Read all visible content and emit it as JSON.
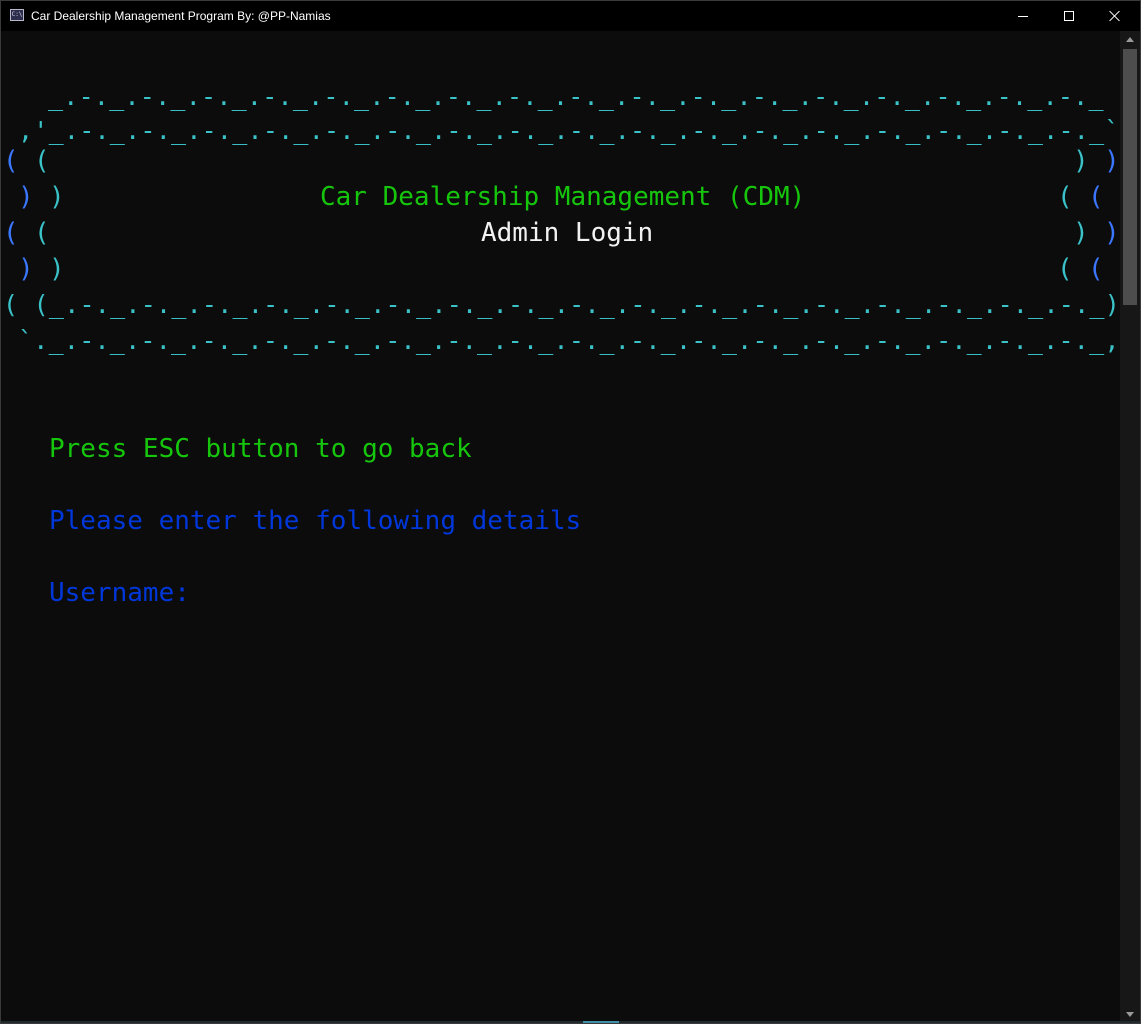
{
  "window": {
    "title": "Car Dealership Management Program By: @PP-Namias",
    "icon_label": "C:\\",
    "controls": {
      "minimize_icon": "minimize-icon",
      "maximize_icon": "maximize-icon",
      "close_icon": "close-icon"
    }
  },
  "banner": {
    "top_edge_1": "_.-._.-._.-._.-._.-._.-._.-._.-._.-._.-._.-._.-._.-._.-._.-._.-._.-._",
    "top_edge_2": ",'_.-._.-._.-._.-._.-._.-._.-._.-._.-._.-._.-._.-._.-._.-._.-._.-._.-._`.",
    "bottom_edge_1": "( (_.-._.-._.-._.-._.-._.-._.-._.-._.-._.-._.-._.-._.-._.-._.-._.-._.-._) )",
    "bottom_edge_2": "`._.-._.-._.-._.-._.-._.-._.-._.-._.-._.-._.-._.-._.-._.-._.-._.-._.-._,'",
    "left_paren_a": "(",
    "left_paren_b": ")",
    "right_paren_a": ")",
    "right_paren_b": "(",
    "title": "Car Dealership Management (CDM)",
    "subtitle": "Admin Login"
  },
  "prompt": {
    "esc_hint": "Press ESC button to go back",
    "instruction": "Please enter the following details",
    "username_label": "Username:"
  },
  "colors": {
    "background": "#0c0c0c",
    "cyan": "#3ac2c8",
    "blue": "#3b78ff",
    "green": "#16c60c",
    "white": "#f2f2f2",
    "dark_blue": "#0037da"
  }
}
